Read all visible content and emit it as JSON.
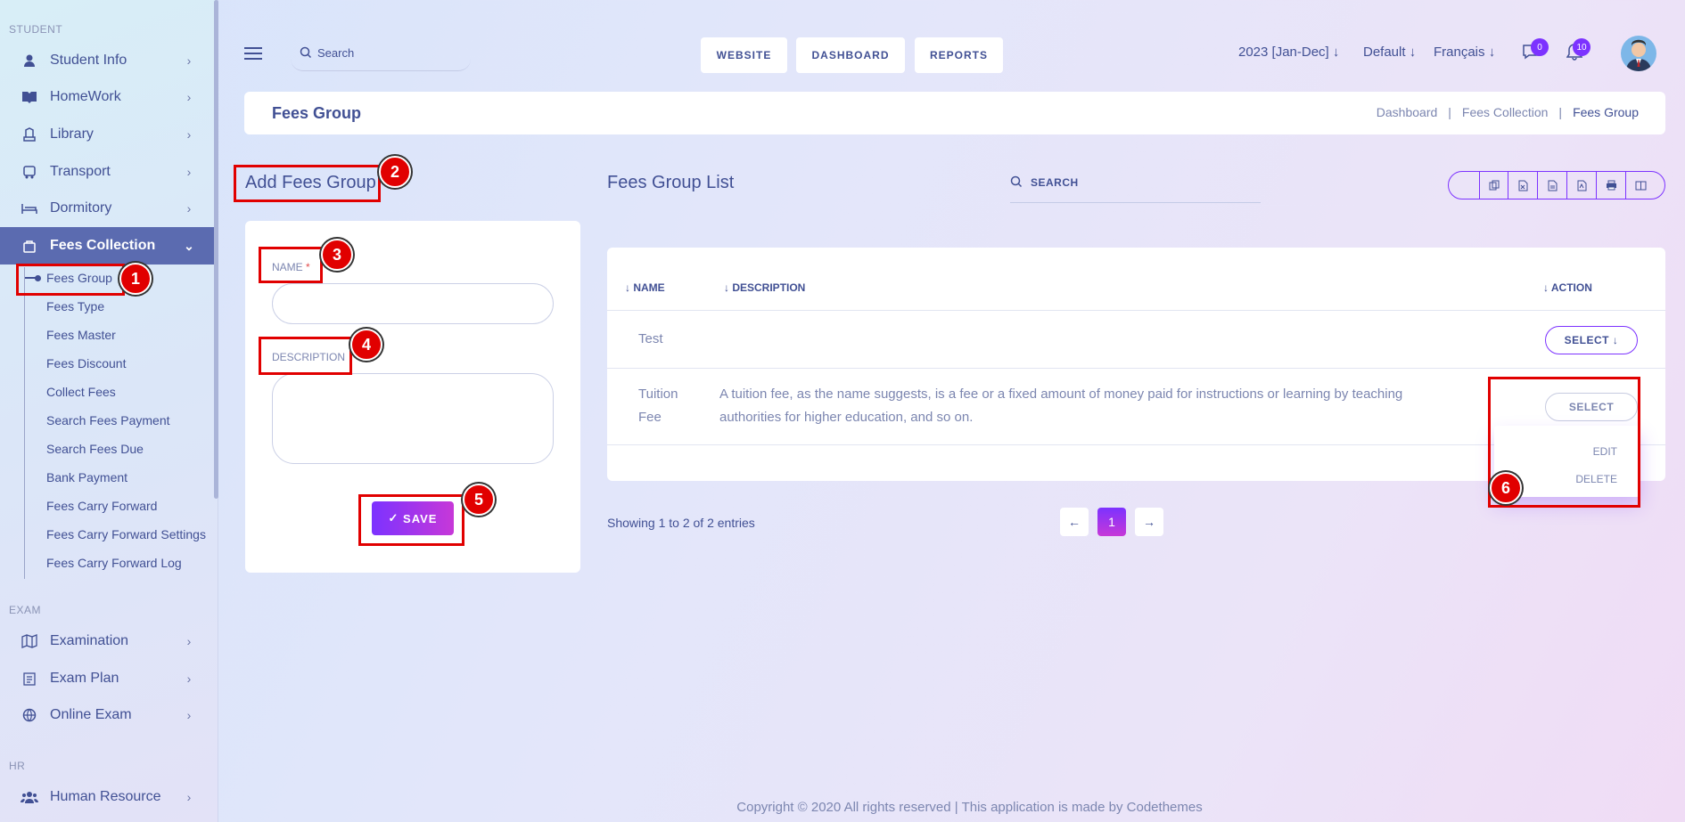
{
  "sidebar": {
    "sections": {
      "student": "STUDENT",
      "exam": "EXAM",
      "hr": "HR"
    },
    "items": [
      {
        "label": "Student Info"
      },
      {
        "label": "HomeWork"
      },
      {
        "label": "Library"
      },
      {
        "label": "Transport"
      },
      {
        "label": "Dormitory"
      },
      {
        "label": "Fees Collection"
      }
    ],
    "sub_items": [
      {
        "label": "Fees Group"
      },
      {
        "label": "Fees Type"
      },
      {
        "label": "Fees Master"
      },
      {
        "label": "Fees Discount"
      },
      {
        "label": "Collect Fees"
      },
      {
        "label": "Search Fees Payment"
      },
      {
        "label": "Search Fees Due"
      },
      {
        "label": "Bank Payment"
      },
      {
        "label": "Fees Carry Forward"
      },
      {
        "label": "Fees Carry Forward Settings"
      },
      {
        "label": "Fees Carry Forward Log"
      }
    ],
    "exam_items": [
      {
        "label": "Examination"
      },
      {
        "label": "Exam Plan"
      },
      {
        "label": "Online Exam"
      }
    ],
    "hr_items": [
      {
        "label": "Human Resource"
      }
    ]
  },
  "topbar": {
    "search_placeholder": "Search",
    "buttons": {
      "website": "WEBSITE",
      "dashboard": "DASHBOARD",
      "reports": "REPORTS"
    },
    "session": "2023 [Jan-Dec]",
    "theme": "Default",
    "language": "Français",
    "chat_count": "0",
    "notification_count": "10"
  },
  "breadcrumb_bar": {
    "title": "Fees Group",
    "crumbs": [
      "Dashboard",
      "Fees Collection",
      "Fees Group"
    ],
    "sep": "|"
  },
  "add_form": {
    "title": "Add Fees Group",
    "name_label": "NAME",
    "required_mark": "*",
    "name_value": "",
    "description_label": "DESCRIPTION",
    "description_value": "",
    "save_label": "SAVE"
  },
  "list": {
    "title": "Fees Group List",
    "search_placeholder": "SEARCH",
    "columns": [
      "NAME",
      "DESCRIPTION",
      "ACTION"
    ],
    "rows": [
      {
        "name": "Test",
        "description": "",
        "action": "SELECT"
      },
      {
        "name": "Tuition Fee",
        "description": "A tuition fee, as the name suggests, is a fee or a fixed amount of money paid for instructions or learning by teaching authorities for higher education, and so on.",
        "action": "SELECT"
      }
    ],
    "dropdown": [
      "EDIT",
      "DELETE"
    ],
    "info": "Showing 1 to 2 of 2 entries",
    "page": "1"
  },
  "annotations": [
    "1",
    "2",
    "3",
    "4",
    "5",
    "6"
  ],
  "footer": "Copyright © 2020 All rights reserved | This application is made by Codethemes",
  "colors": {
    "accent": "#7c32ff",
    "primary_text": "#415094",
    "highlight": "#e10000",
    "sidebar_active": "#5b6bb0"
  }
}
